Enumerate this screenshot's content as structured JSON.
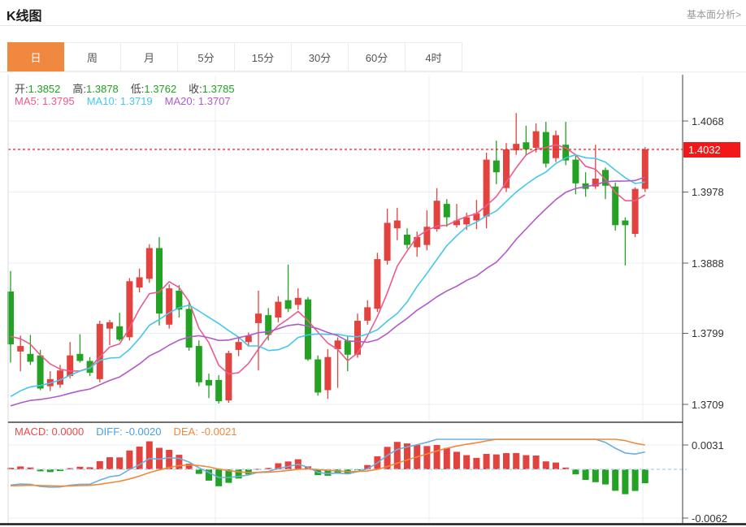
{
  "header": {
    "title": "K线图",
    "analysis_link": "基本面分析>"
  },
  "tabs": {
    "items": [
      "日",
      "周",
      "月",
      "5分",
      "15分",
      "30分",
      "60分",
      "4时"
    ],
    "active": "日"
  },
  "readout": {
    "ohlc": [
      {
        "label": "开:",
        "value": "1.3852"
      },
      {
        "label": "高:",
        "value": "1.3878"
      },
      {
        "label": "低:",
        "value": "1.3762"
      },
      {
        "label": "收:",
        "value": "1.3785"
      }
    ],
    "ohlc_value_color": "#1ea41e",
    "ma": [
      {
        "label": "MA5:",
        "value": "1.3795",
        "color": "#ee5a8c"
      },
      {
        "label": "MA10:",
        "value": "1.3719",
        "color": "#45c8ea"
      },
      {
        "label": "MA20:",
        "value": "1.3707",
        "color": "#b25bc8"
      }
    ],
    "macd": [
      {
        "label": "MACD:",
        "value": "0.0000",
        "color": "#f04848"
      },
      {
        "label": "DIFF:",
        "value": "-0.0020",
        "color": "#48a0e8"
      },
      {
        "label": "DEA:",
        "value": "-0.0021",
        "color": "#f5863a"
      }
    ]
  },
  "axis": {
    "price_labels": [
      "1.4068",
      "1.4032",
      "1.3978",
      "1.3888",
      "1.3799",
      "1.3709"
    ],
    "macd_labels": [
      "0.0031",
      "-0.0062"
    ]
  },
  "chart_data": {
    "type": "candlestick",
    "title": "K线图 (daily K-line with MA5/MA10/MA20 and MACD sub-chart)",
    "price_ticks": [
      1.4068,
      1.3978,
      1.3888,
      1.3799,
      1.3709
    ],
    "macd_ticks": [
      0.0031,
      -0.0062
    ],
    "current_price": 1.4032,
    "ma_initial": {
      "ma5": 1.3795,
      "ma10": 1.3719,
      "ma20": 1.3707
    },
    "macd_initial": {
      "diff": -0.002,
      "dea": -0.0021
    },
    "candles": [
      [
        1.3852,
        1.3878,
        1.3762,
        1.3785
      ],
      [
        1.3776,
        1.3796,
        1.3751,
        1.3783
      ],
      [
        1.3773,
        1.3797,
        1.3759,
        1.3763
      ],
      [
        1.3771,
        1.3778,
        1.3727,
        1.3729
      ],
      [
        1.3732,
        1.3751,
        1.3726,
        1.3741
      ],
      [
        1.3734,
        1.3759,
        1.373,
        1.3752
      ],
      [
        1.3745,
        1.3788,
        1.3742,
        1.3771
      ],
      [
        1.3773,
        1.3798,
        1.3762,
        1.3764
      ],
      [
        1.3764,
        1.3769,
        1.3745,
        1.3749
      ],
      [
        1.3741,
        1.3815,
        1.3737,
        1.3811
      ],
      [
        1.3805,
        1.3816,
        1.3784,
        1.3813
      ],
      [
        1.3808,
        1.3825,
        1.3789,
        1.3791
      ],
      [
        1.3794,
        1.3869,
        1.379,
        1.3865
      ],
      [
        1.3857,
        1.3881,
        1.3851,
        1.387
      ],
      [
        1.3868,
        1.3912,
        1.3863,
        1.3907
      ],
      [
        1.3907,
        1.3921,
        1.3809,
        1.3824
      ],
      [
        1.381,
        1.3861,
        1.3805,
        1.3856
      ],
      [
        1.3853,
        1.386,
        1.3819,
        1.3829
      ],
      [
        1.383,
        1.3838,
        1.3777,
        1.3781
      ],
      [
        1.3783,
        1.379,
        1.3732,
        1.3737
      ],
      [
        1.374,
        1.3748,
        1.3717,
        1.3733
      ],
      [
        1.374,
        1.3746,
        1.371,
        1.3713
      ],
      [
        1.3714,
        1.3777,
        1.3711,
        1.3774
      ],
      [
        1.3778,
        1.3795,
        1.377,
        1.3788
      ],
      [
        1.3788,
        1.38,
        1.3782,
        1.3796
      ],
      [
        1.3812,
        1.3853,
        1.3752,
        1.3824
      ],
      [
        1.3822,
        1.3831,
        1.379,
        1.3797
      ],
      [
        1.3819,
        1.3846,
        1.3813,
        1.3839
      ],
      [
        1.3841,
        1.3886,
        1.3826,
        1.383
      ],
      [
        1.3835,
        1.3856,
        1.3829,
        1.3844
      ],
      [
        1.3842,
        1.3845,
        1.3764,
        1.3766
      ],
      [
        1.3766,
        1.3771,
        1.372,
        1.3724
      ],
      [
        1.3727,
        1.3779,
        1.3716,
        1.3769
      ],
      [
        1.3779,
        1.3794,
        1.373,
        1.379
      ],
      [
        1.379,
        1.3795,
        1.3751,
        1.3772
      ],
      [
        1.3772,
        1.3824,
        1.3768,
        1.3815
      ],
      [
        1.3815,
        1.3841,
        1.381,
        1.3832
      ],
      [
        1.383,
        1.3901,
        1.3826,
        1.3893
      ],
      [
        1.3891,
        1.3957,
        1.3886,
        1.3939
      ],
      [
        1.3932,
        1.3958,
        1.3917,
        1.3942
      ],
      [
        1.3924,
        1.3932,
        1.3906,
        1.3911
      ],
      [
        1.3908,
        1.3928,
        1.3896,
        1.3921
      ],
      [
        1.3911,
        1.3955,
        1.3904,
        1.3934
      ],
      [
        1.3931,
        1.3983,
        1.3928,
        1.3967
      ],
      [
        1.3963,
        1.3969,
        1.3934,
        1.3946
      ],
      [
        1.3936,
        1.3963,
        1.3933,
        1.3942
      ],
      [
        1.3937,
        1.3952,
        1.393,
        1.3946
      ],
      [
        1.3942,
        1.3968,
        1.3931,
        1.3951
      ],
      [
        1.3947,
        1.4028,
        1.3932,
        1.4019
      ],
      [
        1.4018,
        1.4043,
        1.3988,
        1.4003
      ],
      [
        1.3983,
        1.404,
        1.3978,
        1.4032
      ],
      [
        1.4031,
        1.4078,
        1.4025,
        1.4039
      ],
      [
        1.4041,
        1.4062,
        1.4025,
        1.4032
      ],
      [
        1.4034,
        1.4065,
        1.4028,
        1.4055
      ],
      [
        1.4054,
        1.4067,
        1.4009,
        1.4014
      ],
      [
        1.4021,
        1.4056,
        1.4016,
        1.405
      ],
      [
        1.4038,
        1.4067,
        1.4012,
        1.4018
      ],
      [
        1.4019,
        1.4024,
        1.3975,
        1.3989
      ],
      [
        1.3989,
        1.4003,
        1.3972,
        1.3982
      ],
      [
        1.3985,
        1.4038,
        1.3982,
        1.3995
      ],
      [
        1.4006,
        1.4009,
        1.3969,
        1.3986
      ],
      [
        1.3985,
        1.399,
        1.3929,
        1.3936
      ],
      [
        1.3942,
        1.3946,
        1.3885,
        1.3936
      ],
      [
        1.3925,
        1.3984,
        1.3921,
        1.3982
      ],
      [
        1.3982,
        1.4035,
        1.3978,
        1.4032
      ]
    ],
    "colors": {
      "up": "#e2433f",
      "down": "#23a223",
      "ma5": "#ee5a8c",
      "ma10": "#45c8ea",
      "ma20": "#b25bc8",
      "diff_line": "#6cb0e0",
      "dea_line": "#f08a3a",
      "current_line": "#f31b1b",
      "grid": "#e7eef6",
      "zero_dash": "#b5d9ee",
      "tab_active": "#f0883f",
      "badge": "#f01818"
    }
  }
}
